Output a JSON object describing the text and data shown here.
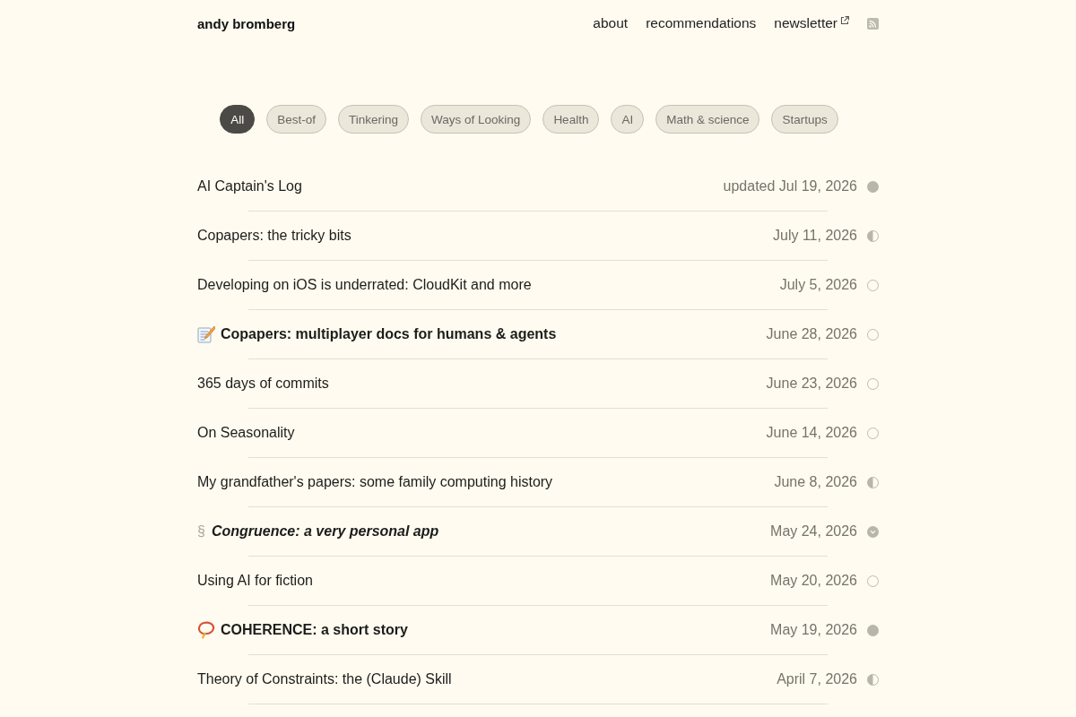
{
  "site": {
    "title": "andy bromberg"
  },
  "nav": [
    {
      "label": "about",
      "external": false
    },
    {
      "label": "recommendations",
      "external": false
    },
    {
      "label": "newsletter",
      "external": true
    }
  ],
  "filters": [
    {
      "label": "All",
      "selected": true
    },
    {
      "label": "Best-of",
      "selected": false
    },
    {
      "label": "Tinkering",
      "selected": false
    },
    {
      "label": "Ways of Looking",
      "selected": false
    },
    {
      "label": "Health",
      "selected": false
    },
    {
      "label": "AI",
      "selected": false
    },
    {
      "label": "Math & science",
      "selected": false
    },
    {
      "label": "Startups",
      "selected": false
    }
  ],
  "posts": [
    {
      "kind": "plain",
      "title": "AI Captain's Log",
      "date": "updated Jul 19, 2026",
      "status": {
        "kind": "full"
      }
    },
    {
      "kind": "plain",
      "title": "Copapers: the tricky bits",
      "date": "July 11, 2026",
      "status": {
        "kind": "half"
      }
    },
    {
      "kind": "plain",
      "title": "Developing on iOS is underrated: CloudKit and more",
      "date": "July 5, 2026",
      "status": {
        "kind": "empty"
      }
    },
    {
      "kind": "note",
      "title": "Copapers: multiplayer docs for humans & agents",
      "date": "June 28, 2026",
      "status": {
        "kind": "empty"
      }
    },
    {
      "kind": "plain",
      "title": "365 days of commits",
      "date": "June 23, 2026",
      "status": {
        "kind": "empty"
      }
    },
    {
      "kind": "plain",
      "title": "On Seasonality",
      "date": "June 14, 2026",
      "status": {
        "kind": "empty"
      }
    },
    {
      "kind": "plain",
      "title": "My grandfather's papers: some family computing history",
      "date": "June 8, 2026",
      "status": {
        "kind": "half"
      }
    },
    {
      "kind": "section",
      "prefix": "§",
      "title": "Congruence: a very personal app",
      "date": "May 24, 2026",
      "status": {
        "kind": "check"
      }
    },
    {
      "kind": "plain",
      "title": "Using AI for fiction",
      "date": "May 20, 2026",
      "status": {
        "kind": "empty"
      }
    },
    {
      "kind": "story",
      "title": "COHERENCE: a short story",
      "date": "May 19, 2026",
      "status": {
        "kind": "full"
      }
    },
    {
      "kind": "plain",
      "title": "Theory of Constraints: the (Claude) Skill",
      "date": "April 7, 2026",
      "status": {
        "kind": "half"
      }
    }
  ]
}
